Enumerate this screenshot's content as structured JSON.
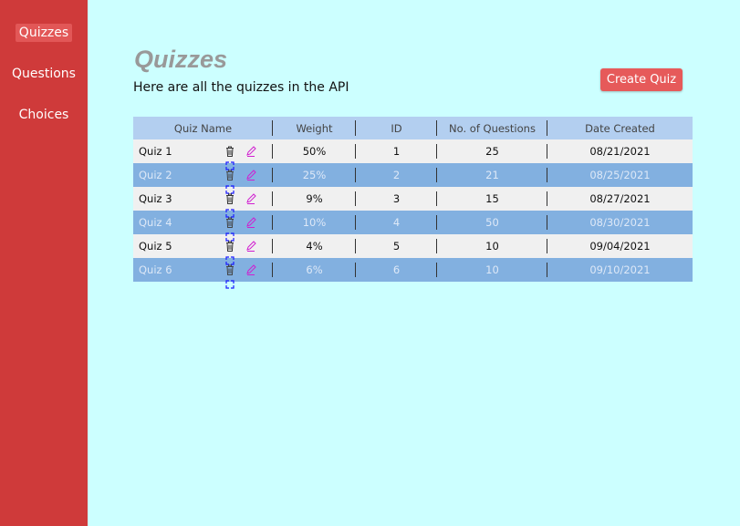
{
  "sidebar": {
    "items": [
      {
        "label": "Quizzes",
        "active": true
      },
      {
        "label": "Questions",
        "active": false
      },
      {
        "label": "Choices",
        "active": false
      }
    ]
  },
  "header": {
    "title": "Quizzes",
    "subtitle": "Here are all the quizzes in the API",
    "create_button": "Create Quiz"
  },
  "table": {
    "columns": [
      "Quiz Name",
      "Weight",
      "ID",
      "No. of Questions",
      "Date Created"
    ],
    "rows": [
      {
        "name": "Quiz 1",
        "weight": "50%",
        "id": "1",
        "questions": "25",
        "date": "08/21/2021"
      },
      {
        "name": "Quiz 2",
        "weight": "25%",
        "id": "2",
        "questions": "21",
        "date": "08/25/2021"
      },
      {
        "name": "Quiz 3",
        "weight": "9%",
        "id": "3",
        "questions": "15",
        "date": "08/27/2021"
      },
      {
        "name": "Quiz 4",
        "weight": "10%",
        "id": "4",
        "questions": "50",
        "date": "08/30/2021"
      },
      {
        "name": "Quiz 5",
        "weight": "4%",
        "id": "5",
        "questions": "10",
        "date": "09/04/2021"
      },
      {
        "name": "Quiz 6",
        "weight": "6%",
        "id": "6",
        "questions": "10",
        "date": "09/10/2021"
      }
    ],
    "row_actions": [
      "trash-icon",
      "pencil-icon",
      "expand-icon"
    ]
  },
  "colors": {
    "sidebar": "#cf3a3a",
    "background": "#ccffff",
    "button": "#e65a5a",
    "header_row": "#b3cff0",
    "row_light": "#f0f0f0",
    "row_dark": "#82b0e0",
    "edit_icon": "#d01ed0",
    "expand_icon": "#1a1aff"
  }
}
